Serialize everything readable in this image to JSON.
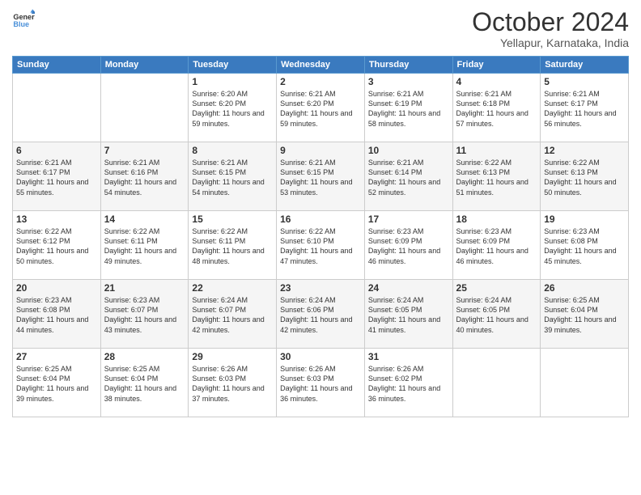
{
  "logo": {
    "line1": "General",
    "line2": "Blue"
  },
  "title": "October 2024",
  "location": "Yellapur, Karnataka, India",
  "days_of_week": [
    "Sunday",
    "Monday",
    "Tuesday",
    "Wednesday",
    "Thursday",
    "Friday",
    "Saturday"
  ],
  "weeks": [
    [
      {
        "day": "",
        "info": ""
      },
      {
        "day": "",
        "info": ""
      },
      {
        "day": "1",
        "info": "Sunrise: 6:20 AM\nSunset: 6:20 PM\nDaylight: 11 hours and 59 minutes."
      },
      {
        "day": "2",
        "info": "Sunrise: 6:21 AM\nSunset: 6:20 PM\nDaylight: 11 hours and 59 minutes."
      },
      {
        "day": "3",
        "info": "Sunrise: 6:21 AM\nSunset: 6:19 PM\nDaylight: 11 hours and 58 minutes."
      },
      {
        "day": "4",
        "info": "Sunrise: 6:21 AM\nSunset: 6:18 PM\nDaylight: 11 hours and 57 minutes."
      },
      {
        "day": "5",
        "info": "Sunrise: 6:21 AM\nSunset: 6:17 PM\nDaylight: 11 hours and 56 minutes."
      }
    ],
    [
      {
        "day": "6",
        "info": "Sunrise: 6:21 AM\nSunset: 6:17 PM\nDaylight: 11 hours and 55 minutes."
      },
      {
        "day": "7",
        "info": "Sunrise: 6:21 AM\nSunset: 6:16 PM\nDaylight: 11 hours and 54 minutes."
      },
      {
        "day": "8",
        "info": "Sunrise: 6:21 AM\nSunset: 6:15 PM\nDaylight: 11 hours and 54 minutes."
      },
      {
        "day": "9",
        "info": "Sunrise: 6:21 AM\nSunset: 6:15 PM\nDaylight: 11 hours and 53 minutes."
      },
      {
        "day": "10",
        "info": "Sunrise: 6:21 AM\nSunset: 6:14 PM\nDaylight: 11 hours and 52 minutes."
      },
      {
        "day": "11",
        "info": "Sunrise: 6:22 AM\nSunset: 6:13 PM\nDaylight: 11 hours and 51 minutes."
      },
      {
        "day": "12",
        "info": "Sunrise: 6:22 AM\nSunset: 6:13 PM\nDaylight: 11 hours and 50 minutes."
      }
    ],
    [
      {
        "day": "13",
        "info": "Sunrise: 6:22 AM\nSunset: 6:12 PM\nDaylight: 11 hours and 50 minutes."
      },
      {
        "day": "14",
        "info": "Sunrise: 6:22 AM\nSunset: 6:11 PM\nDaylight: 11 hours and 49 minutes."
      },
      {
        "day": "15",
        "info": "Sunrise: 6:22 AM\nSunset: 6:11 PM\nDaylight: 11 hours and 48 minutes."
      },
      {
        "day": "16",
        "info": "Sunrise: 6:22 AM\nSunset: 6:10 PM\nDaylight: 11 hours and 47 minutes."
      },
      {
        "day": "17",
        "info": "Sunrise: 6:23 AM\nSunset: 6:09 PM\nDaylight: 11 hours and 46 minutes."
      },
      {
        "day": "18",
        "info": "Sunrise: 6:23 AM\nSunset: 6:09 PM\nDaylight: 11 hours and 46 minutes."
      },
      {
        "day": "19",
        "info": "Sunrise: 6:23 AM\nSunset: 6:08 PM\nDaylight: 11 hours and 45 minutes."
      }
    ],
    [
      {
        "day": "20",
        "info": "Sunrise: 6:23 AM\nSunset: 6:08 PM\nDaylight: 11 hours and 44 minutes."
      },
      {
        "day": "21",
        "info": "Sunrise: 6:23 AM\nSunset: 6:07 PM\nDaylight: 11 hours and 43 minutes."
      },
      {
        "day": "22",
        "info": "Sunrise: 6:24 AM\nSunset: 6:07 PM\nDaylight: 11 hours and 42 minutes."
      },
      {
        "day": "23",
        "info": "Sunrise: 6:24 AM\nSunset: 6:06 PM\nDaylight: 11 hours and 42 minutes."
      },
      {
        "day": "24",
        "info": "Sunrise: 6:24 AM\nSunset: 6:05 PM\nDaylight: 11 hours and 41 minutes."
      },
      {
        "day": "25",
        "info": "Sunrise: 6:24 AM\nSunset: 6:05 PM\nDaylight: 11 hours and 40 minutes."
      },
      {
        "day": "26",
        "info": "Sunrise: 6:25 AM\nSunset: 6:04 PM\nDaylight: 11 hours and 39 minutes."
      }
    ],
    [
      {
        "day": "27",
        "info": "Sunrise: 6:25 AM\nSunset: 6:04 PM\nDaylight: 11 hours and 39 minutes."
      },
      {
        "day": "28",
        "info": "Sunrise: 6:25 AM\nSunset: 6:04 PM\nDaylight: 11 hours and 38 minutes."
      },
      {
        "day": "29",
        "info": "Sunrise: 6:26 AM\nSunset: 6:03 PM\nDaylight: 11 hours and 37 minutes."
      },
      {
        "day": "30",
        "info": "Sunrise: 6:26 AM\nSunset: 6:03 PM\nDaylight: 11 hours and 36 minutes."
      },
      {
        "day": "31",
        "info": "Sunrise: 6:26 AM\nSunset: 6:02 PM\nDaylight: 11 hours and 36 minutes."
      },
      {
        "day": "",
        "info": ""
      },
      {
        "day": "",
        "info": ""
      }
    ]
  ]
}
